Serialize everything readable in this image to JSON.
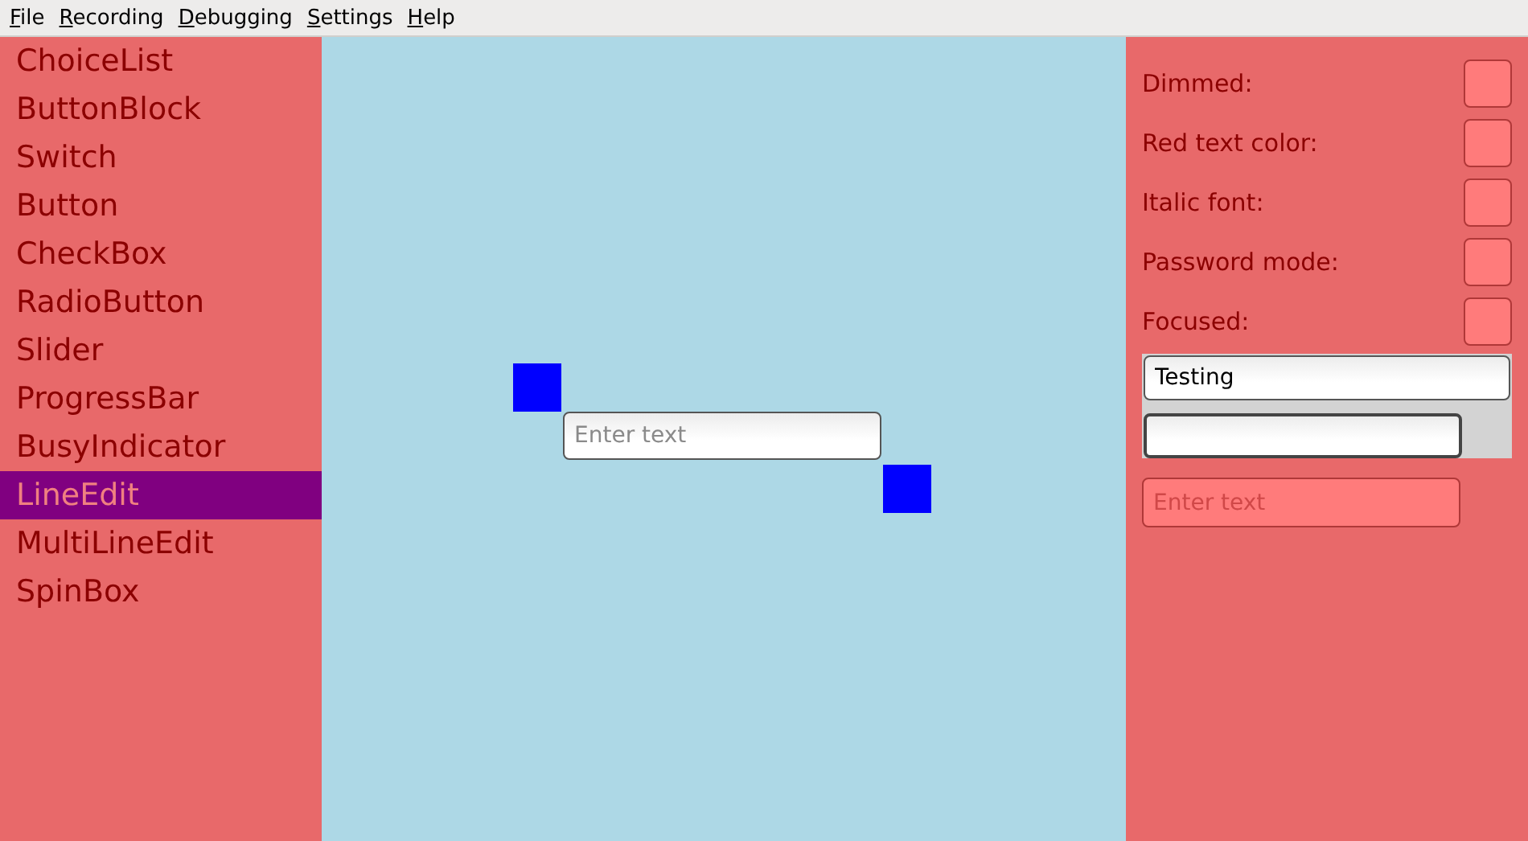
{
  "menu_bar": [
    "File",
    "Recording",
    "Debugging",
    "Settings",
    "Help"
  ],
  "sidebar": {
    "items": [
      {
        "label": "ChoiceList",
        "selected": false
      },
      {
        "label": "ButtonBlock",
        "selected": false
      },
      {
        "label": "Switch",
        "selected": false
      },
      {
        "label": "Button",
        "selected": false
      },
      {
        "label": "CheckBox",
        "selected": false
      },
      {
        "label": "RadioButton",
        "selected": false
      },
      {
        "label": "Slider",
        "selected": false
      },
      {
        "label": "ProgressBar",
        "selected": false
      },
      {
        "label": "BusyIndicator",
        "selected": false
      },
      {
        "label": "LineEdit",
        "selected": true
      },
      {
        "label": "MultiLineEdit",
        "selected": false
      },
      {
        "label": "SpinBox",
        "selected": false
      }
    ]
  },
  "canvas": {
    "line_edit": {
      "placeholder": "Enter text"
    }
  },
  "settings": {
    "options": [
      {
        "label": "Dimmed:",
        "checked": false
      },
      {
        "label": "Red text color:",
        "checked": false
      },
      {
        "label": "Italic font:",
        "checked": false
      },
      {
        "label": "Password mode:",
        "checked": false
      },
      {
        "label": "Focused:",
        "checked": false
      }
    ],
    "fields": [
      {
        "value": "Testing",
        "focused": false
      },
      {
        "focused": true
      }
    ],
    "styled_field": {
      "placeholder": "Enter text"
    }
  }
}
